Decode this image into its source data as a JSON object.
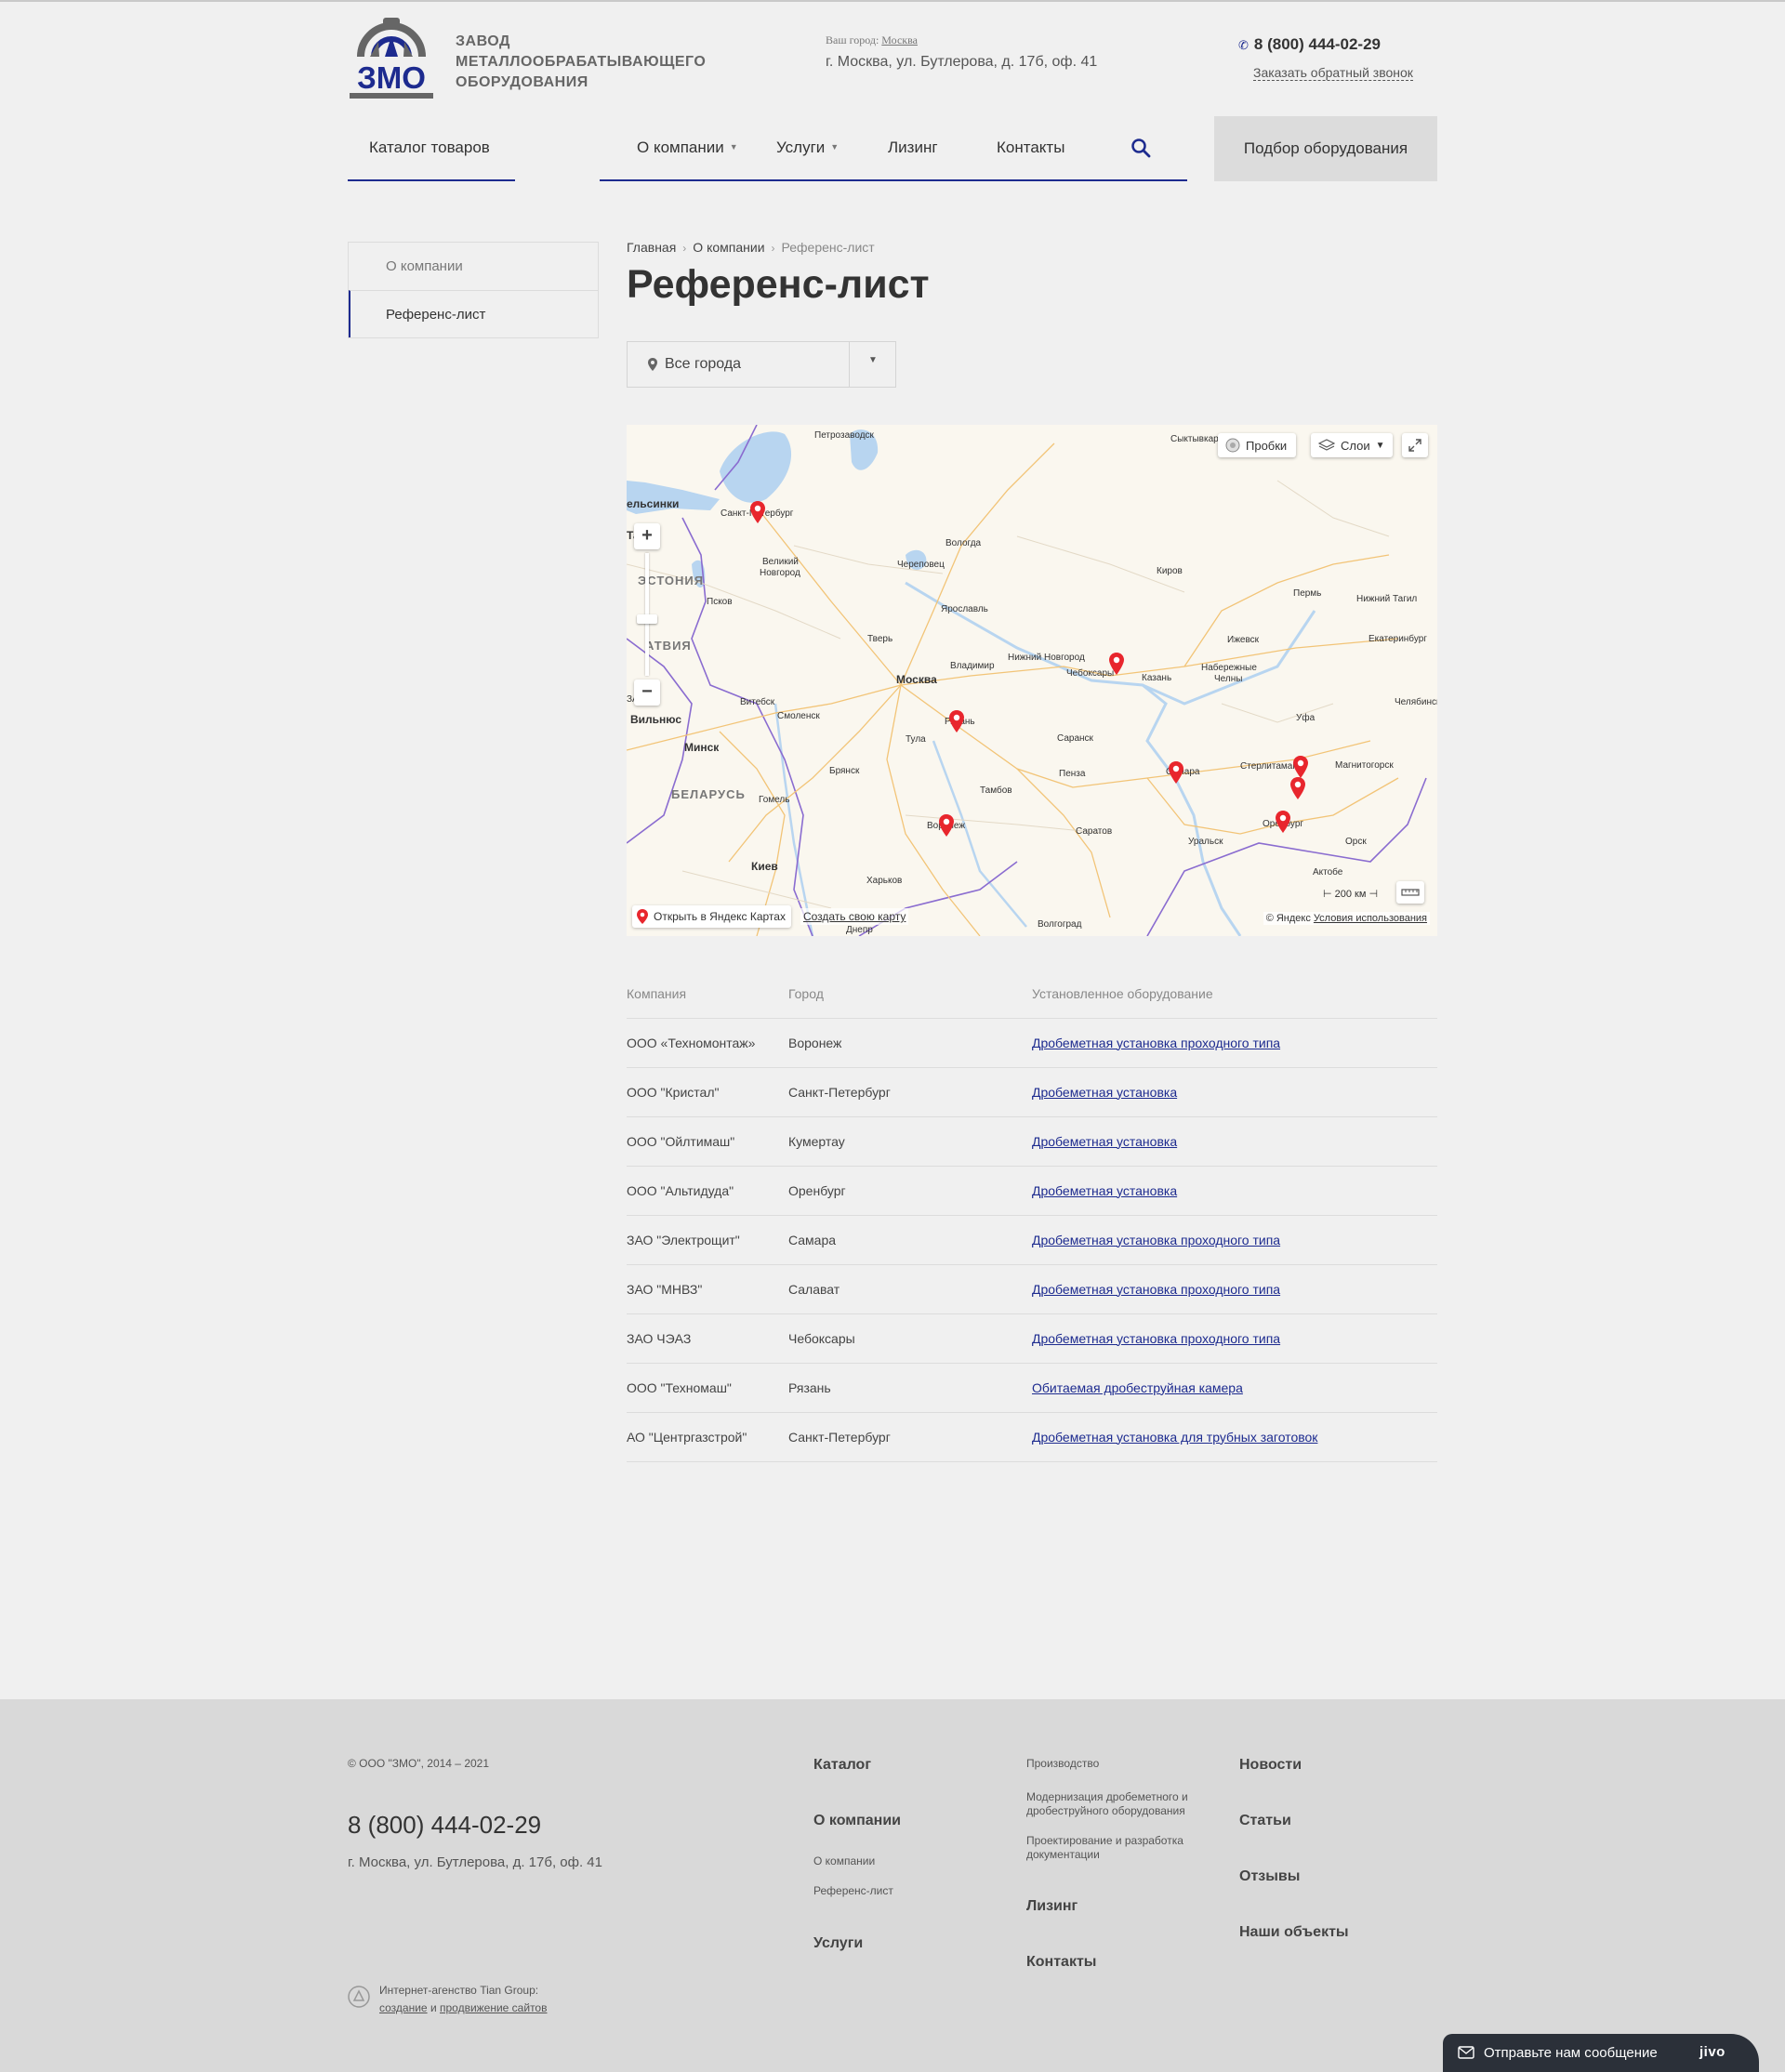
{
  "header": {
    "brand_lines": [
      "ЗАВОД",
      "МЕТАЛЛООБРАБАТЫВАЮЩЕГО",
      "ОБОРУДОВАНИЯ"
    ],
    "logo_text": "ЗМО",
    "city_label": "Ваш город:",
    "city": "Москва",
    "address": "г. Москва, ул. Бутлерова, д. 17б, оф. 41",
    "phone": "8 (800) 444-02-29",
    "callback": "Заказать обратный звонок"
  },
  "nav": {
    "catalog": "Каталог товаров",
    "items": [
      {
        "label": "О компании",
        "has_dropdown": true
      },
      {
        "label": "Услуги",
        "has_dropdown": true
      },
      {
        "label": "Лизинг",
        "has_dropdown": false
      },
      {
        "label": "Контакты",
        "has_dropdown": false
      }
    ],
    "pick_button": "Подбор оборудования"
  },
  "sidebar": {
    "items": [
      {
        "label": "О компании",
        "active": false
      },
      {
        "label": "Референс-лист",
        "active": true
      }
    ]
  },
  "breadcrumbs": [
    "Главная",
    "О компании",
    "Референс-лист"
  ],
  "page_title": "Референс-лист",
  "city_filter": {
    "value": "Все города"
  },
  "map": {
    "traffic_label": "Пробки",
    "layers_label": "Слои",
    "open_label": "Открыть в Яндекс Картах",
    "create_label": "Создать свою карту",
    "copyright": "© Яндекс",
    "terms": "Условия использования",
    "scale": "200 км",
    "cities": {
      "petrozavodsk": "Петрозаводск",
      "syktyvkar": "Сыктывкар",
      "helsinki": "ельсинки",
      "spb": "Санкт-Петербург",
      "tallinn": "Та",
      "vnovgorod_1": "Великий",
      "vnovgorod_2": "Новгород",
      "vologda": "Вологда",
      "cherepovets": "Череповец",
      "kirov": "Киров",
      "perm": "Пермь",
      "ntagil": "Нижний Тагил",
      "estonia": "ЭСТОНИЯ",
      "pskov": "Псков",
      "yaroslavl": "Ярославль",
      "latvia": "АТВИЯ",
      "tver": "Тверь",
      "izhevsk": "Ижевск",
      "ekb": "Екатеринбург",
      "nnovgorod": "Нижний Новгород",
      "vladimir": "Владимир",
      "cheboksary": "Чебоксары",
      "moscow": "Москва",
      "kazan": "Казань",
      "nchelny_1": "Набережные",
      "nchelny_2": "Челны",
      "vitebsk": "Витебск",
      "smolensk": "Смоленск",
      "chelyabinsk": "Челябинск",
      "vilnius": "Вильнюс",
      "ryazan": "Рязань",
      "ufa": "Уфа",
      "la": "ЗА",
      "saransk": "Саранск",
      "tula": "Тула",
      "minsk": "Минск",
      "sterlitamak": "Стерлитамак",
      "magnitogorsk": "Магнитогорск",
      "samara": "Самара",
      "penza": "Пенза",
      "bryansk": "Брянск",
      "belarus": "БЕЛАРУСЬ",
      "tambov": "Тамбов",
      "gomel": "Гомель",
      "orenburg": "Оренбург",
      "voronezh": "Воронеж",
      "saratov": "Саратов",
      "uralsk": "Уральск",
      "orsk": "Орск",
      "kiev": "Киев",
      "aktobe": "Актобе",
      "kharkov": "Харьков",
      "volgograd": "Волгоград",
      "dnepr": "Днепр"
    }
  },
  "table": {
    "headers": [
      "Компания",
      "Город",
      "Установленное оборудование"
    ],
    "rows": [
      {
        "company": "ООО «Техномонтаж»",
        "city": "Воронеж",
        "equipment": "Дробеметная установка проходного типа"
      },
      {
        "company": "ООО \"Кристал\"",
        "city": "Санкт-Петербург",
        "equipment": "Дробеметная установка"
      },
      {
        "company": "ООО \"Ойлтимаш\"",
        "city": "Кумертау",
        "equipment": "Дробеметная установка"
      },
      {
        "company": "ООО \"Альтидуда\"",
        "city": "Оренбург",
        "equipment": "Дробеметная установка"
      },
      {
        "company": "ЗАО \"Электрощит\"",
        "city": "Самара",
        "equipment": "Дробеметная установка проходного типа"
      },
      {
        "company": "ЗАО \"МНВЗ\"",
        "city": "Салават",
        "equipment": "Дробеметная установка проходного типа"
      },
      {
        "company": "ЗАО ЧЭАЗ",
        "city": "Чебоксары",
        "equipment": "Дробеметная установка проходного типа"
      },
      {
        "company": "ООО \"Техномаш\"",
        "city": "Рязань",
        "equipment": "Обитаемая дробеструйная камера"
      },
      {
        "company": "АО \"Центргазстрой\"",
        "city": "Санкт-Петербург",
        "equipment": "Дробеметная установка для трубных заготовок"
      }
    ]
  },
  "footer": {
    "copyright": "© ООО \"ЗМО\", 2014 – 2021",
    "phone": "8 (800) 444-02-29",
    "address": "г. Москва, ул. Бутлерова, д. 17б, оф. 41",
    "col1": {
      "catalog": "Каталог",
      "about": "О компании",
      "about_sub": [
        "О компании",
        "Референс-лист"
      ],
      "services": "Услуги"
    },
    "col2": {
      "sub": [
        "Производство",
        "Модернизация дробеметного и дробеструйного оборудования",
        "Проектирование и разработка документации"
      ],
      "leasing": "Лизинг",
      "contacts": "Контакты"
    },
    "col3": [
      "Новости",
      "Статьи",
      "Отзывы",
      "Наши объекты"
    ],
    "agency_line1": "Интернет-агенство Tian Group:",
    "agency_link1": "создание",
    "agency_and": "и",
    "agency_link2": "продвижение сайтов"
  },
  "jivo": {
    "text": "Отправьте нам сообщение",
    "brand": "jivo"
  }
}
